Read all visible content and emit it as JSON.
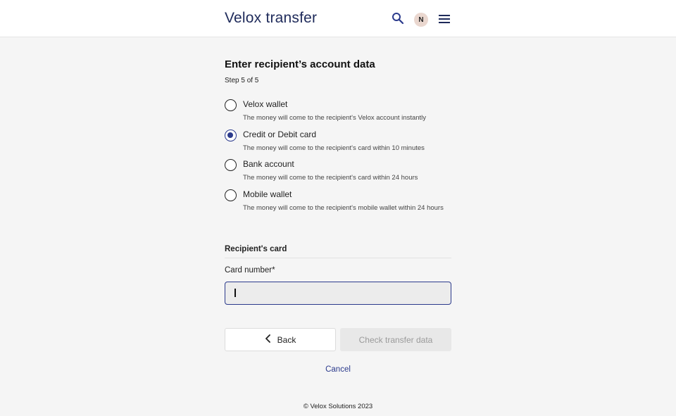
{
  "header": {
    "logo_brand": "Velox",
    "logo_rest": " transfer",
    "avatar_initial": "N",
    "icons": [
      "search-icon",
      "menu-icon"
    ]
  },
  "page": {
    "title": "Enter recipient’s account data",
    "step": "Step 5 of 5"
  },
  "options": [
    {
      "label": "Velox wallet",
      "desc": "The money will come to the recipient's Velox account instantly",
      "selected": false
    },
    {
      "label": "Credit or Debit card",
      "desc": "The money will come to the recipient's card within 10 minutes",
      "selected": true
    },
    {
      "label": "Bank account",
      "desc": "The money will come to the recipient's card within 24 hours",
      "selected": false
    },
    {
      "label": "Mobile wallet",
      "desc": "The money will come to the recipient's mobile wallet within 24 hours",
      "selected": false
    }
  ],
  "recipient": {
    "section_title": "Recipient's card",
    "card_label": "Card number*",
    "card_value": ""
  },
  "actions": {
    "back": "Back",
    "check": "Check transfer data",
    "cancel": "Cancel"
  },
  "footer": "© Velox Solutions 2023",
  "colors": {
    "accent": "#2b3a8c",
    "logo": "#1e2a5a",
    "background": "#f5f5f5",
    "avatar_bg": "#ead7cf"
  }
}
